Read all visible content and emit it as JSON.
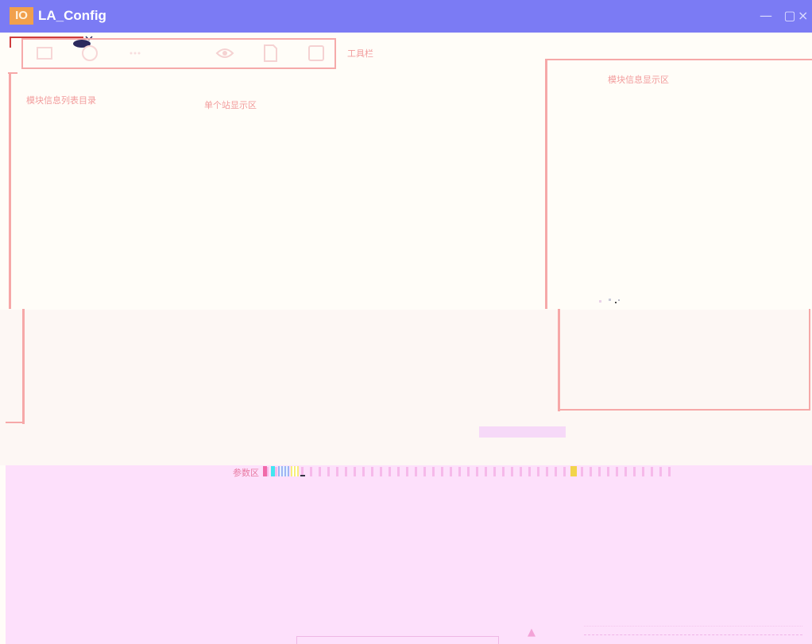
{
  "window": {
    "title": "LA_Config",
    "icon_label": "IO",
    "controls": {
      "minimize": "—",
      "maximize": "▢",
      "close": "×"
    }
  },
  "annotations": {
    "toolbar": "工具栏",
    "module_list": "模块信息列表目录",
    "station_display": "单个站显示区",
    "module_info": "模块信息显示区",
    "params": "参数区"
  },
  "toolbar": {
    "icons": [
      "box-icon",
      "globe-icon",
      "more-icon",
      "eye-icon",
      "document-icon",
      "square-icon"
    ]
  },
  "colors": {
    "title_bar": "#7b7bf4",
    "app_icon": "#f1a04c",
    "annotation": "#f6a8a8",
    "params_area": "#fde0fb"
  }
}
